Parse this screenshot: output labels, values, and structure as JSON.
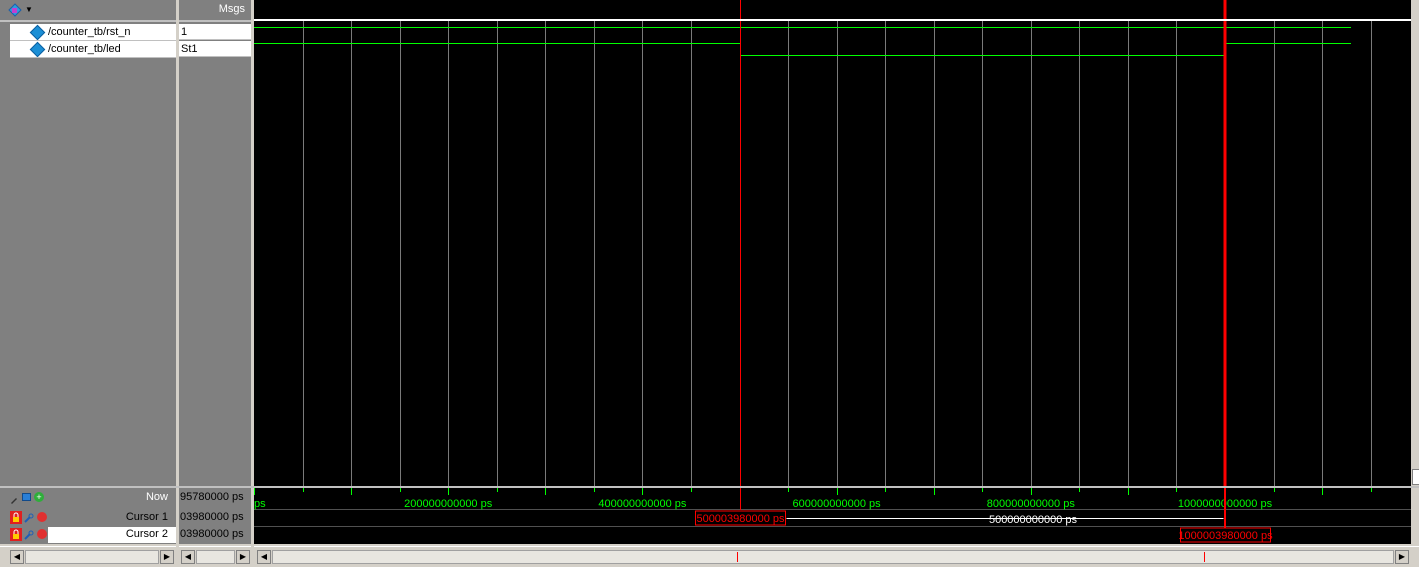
{
  "header": {
    "msgs_label": "Msgs"
  },
  "signals": [
    {
      "name": "/counter_tb/rst_n",
      "value": "1"
    },
    {
      "name": "/counter_tb/led",
      "value": "St1"
    }
  ],
  "cursors": {
    "now_label": "Now",
    "now_value": "95780000 ps",
    "cursor1_label": "Cursor 1",
    "cursor1_value": "03980000 ps",
    "cursor2_label": "Cursor 2",
    "cursor2_value": "03980000 ps"
  },
  "timeline": {
    "ticks": [
      "ps",
      "200000000000 ps",
      "400000000000 ps",
      "600000000000 ps",
      "800000000000 ps",
      "1000000000000 ps"
    ],
    "tick_values_ps": [
      0,
      200000000000,
      400000000000,
      600000000000,
      800000000000,
      1000000000000
    ],
    "cursor1_time_label": "500003980000 ps",
    "cursor2_time_label": "1000003980000 ps",
    "delta_label": "500000000000 ps",
    "cursor1_time_ps": 500003980000,
    "cursor2_time_ps": 1000003980000
  },
  "colors": {
    "wave": "#00ff00",
    "cursor": "#ff0000",
    "grid": "#7a7a7a",
    "background": "#000000",
    "transition": "#ffff00"
  }
}
